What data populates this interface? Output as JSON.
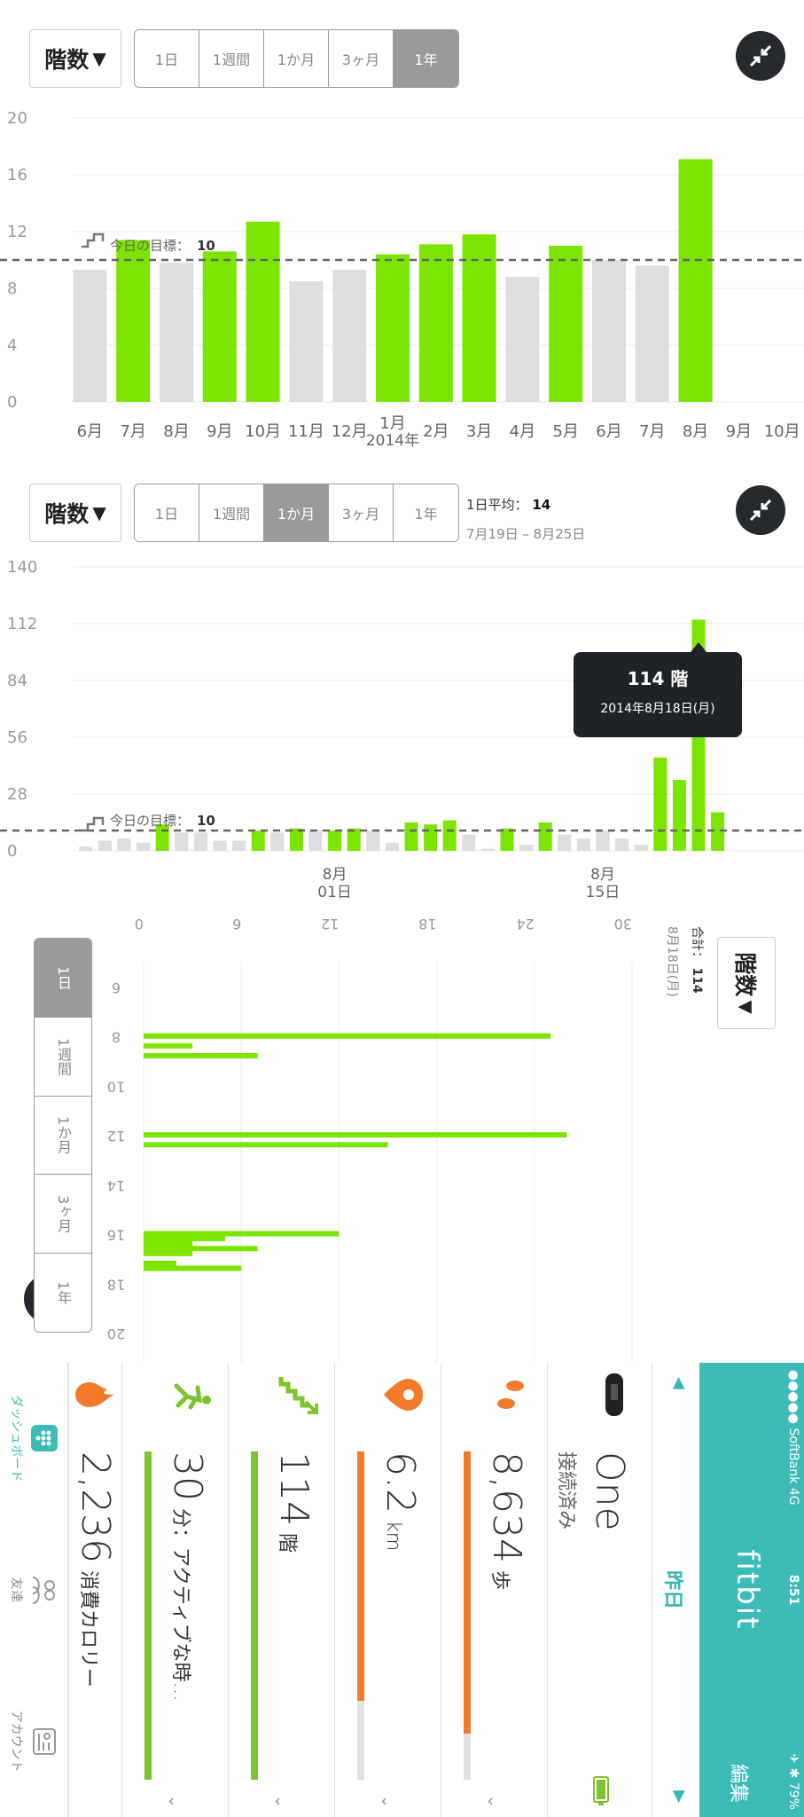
{
  "year_view": {
    "metric_label": "階数",
    "ranges": [
      "1日",
      "1週間",
      "1か月",
      "3ヶ月",
      "1年"
    ],
    "active_range": "1年",
    "goal_label": "今日の目標：",
    "goal_value": "10",
    "chart_data": {
      "type": "bar",
      "ylim": [
        0,
        20
      ],
      "yticks": [
        "0",
        "4",
        "8",
        "12",
        "16",
        "20"
      ],
      "goal": 10,
      "bars": [
        {
          "x": "6月",
          "value": 9.3,
          "met": false
        },
        {
          "x": "7月",
          "value": 11.4,
          "met": true
        },
        {
          "x": "8月",
          "value": 9.8,
          "met": false
        },
        {
          "x": "9月",
          "value": 10.6,
          "met": true
        },
        {
          "x": "10月",
          "value": 12.7,
          "met": true
        },
        {
          "x": "11月",
          "value": 8.5,
          "met": false
        },
        {
          "x": "12月",
          "value": 9.3,
          "met": false
        },
        {
          "x": "1月",
          "value": 10.4,
          "met": true
        },
        {
          "x": "2月",
          "value": 11.1,
          "met": true
        },
        {
          "x": "3月",
          "value": 11.8,
          "met": true
        },
        {
          "x": "4月",
          "value": 8.8,
          "met": false
        },
        {
          "x": "5月",
          "value": 11.0,
          "met": true
        },
        {
          "x": "6月",
          "value": 10.0,
          "met": false
        },
        {
          "x": "7月",
          "value": 9.6,
          "met": false
        },
        {
          "x": "8月",
          "value": 17.1,
          "met": true
        }
      ],
      "xlabels": [
        "6月",
        "7月",
        "8月",
        "9月",
        "10月",
        "11月",
        "12月",
        "1月",
        "2月",
        "3月",
        "4月",
        "5月",
        "6月",
        "7月",
        "8月",
        "9月",
        "10月",
        "1"
      ],
      "year_label": "2014年"
    }
  },
  "month_view": {
    "metric_label": "階数",
    "ranges": [
      "1日",
      "1週間",
      "1か月",
      "3ヶ月",
      "1年"
    ],
    "active_range": "1か月",
    "avg_label": "1日平均：",
    "avg_value": "14",
    "date_range": "7月19日 – 8月25日",
    "goal_label": "今日の目標：",
    "goal_value": "10",
    "tooltip_value": "114 階",
    "tooltip_date": "2014年8月18日(月)",
    "chart_data": {
      "type": "bar",
      "ylim": [
        0,
        140
      ],
      "yticks": [
        "0",
        "28",
        "56",
        "84",
        "112",
        "140"
      ],
      "goal": 10,
      "values": [
        2,
        5,
        6,
        4,
        13,
        9,
        9,
        5,
        5,
        10,
        9,
        11,
        10,
        10,
        11,
        10,
        4,
        14,
        13,
        15,
        8,
        1,
        11,
        3,
        14,
        8,
        6,
        10,
        6,
        3,
        46,
        35,
        114,
        19
      ],
      "met": [
        false,
        false,
        false,
        false,
        true,
        false,
        false,
        false,
        false,
        true,
        false,
        true,
        false,
        true,
        true,
        false,
        false,
        true,
        true,
        true,
        false,
        false,
        true,
        false,
        true,
        false,
        false,
        false,
        false,
        false,
        true,
        true,
        true,
        true
      ],
      "xlabels": [
        {
          "m": "8月",
          "d": "01日",
          "index": 13
        },
        {
          "m": "8月",
          "d": "15日",
          "index": 27
        }
      ]
    }
  },
  "day_view": {
    "metric_label": "階数",
    "ranges": [
      "1日",
      "1週間",
      "1か月",
      "3ヶ月",
      "1年"
    ],
    "active_range": "1日",
    "total_label": "合計：",
    "total_value": "114",
    "date": "8月18日(月)",
    "chart_data": {
      "type": "bar",
      "orientation": "vertical",
      "x_ticks": [
        "6",
        "8",
        "10",
        "12",
        "14",
        "16",
        "18",
        "20"
      ],
      "y_ticks": [
        "0",
        "6",
        "12",
        "18",
        "24",
        "30"
      ],
      "xlim": [
        6,
        20.5
      ],
      "ylim": [
        0,
        30
      ],
      "bars": [
        {
          "t": 8.0,
          "v": 25
        },
        {
          "t": 8.4,
          "v": 3
        },
        {
          "t": 8.8,
          "v": 7
        },
        {
          "t": 12.0,
          "v": 26
        },
        {
          "t": 12.4,
          "v": 15
        },
        {
          "t": 16.0,
          "v": 12
        },
        {
          "t": 16.2,
          "v": 5
        },
        {
          "t": 16.4,
          "v": 3
        },
        {
          "t": 16.6,
          "v": 7
        },
        {
          "t": 16.8,
          "v": 3
        },
        {
          "t": 17.2,
          "v": 2
        },
        {
          "t": 17.4,
          "v": 6
        }
      ]
    }
  },
  "dashboard": {
    "status": {
      "carrier": "●●●●● SoftBank  4G",
      "time": "8:51",
      "battery": "✈ ✱ 79%"
    },
    "logo": "fitbit",
    "edit_label": "編集",
    "date_label": "昨日",
    "device": {
      "name": "One",
      "status": "接続済み"
    },
    "steps": {
      "value": "8,634",
      "unit": "歩",
      "progress": 0.86,
      "color": "#f57b2a"
    },
    "distance": {
      "value": "6.2",
      "unit": "km",
      "progress": 0.76,
      "color": "#f57b2a"
    },
    "floors": {
      "value": "114",
      "unit": "階",
      "progress": 1.0,
      "color": "#7cc52d"
    },
    "active": {
      "value": "30",
      "unit": "分：アクティブな時…",
      "progress": 1.0,
      "color": "#7cc52d"
    },
    "calories": {
      "value": "2,236",
      "unit": "消費カロリー"
    },
    "tabs": [
      "ダッシュボード",
      "友達",
      "アカウント"
    ]
  }
}
